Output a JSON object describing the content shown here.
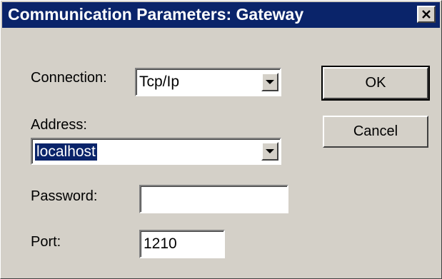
{
  "window": {
    "title": "Communication Parameters: Gateway",
    "close_glyph": "✕"
  },
  "form": {
    "connection_label": "Connection:",
    "connection_value": "Tcp/Ip",
    "address_label": "Address:",
    "address_value": "localhost",
    "password_label": "Password:",
    "password_value": "",
    "port_label": "Port:",
    "port_value": "1210"
  },
  "buttons": {
    "ok_label": "OK",
    "cancel_label": "Cancel"
  },
  "icons": {
    "close": "close-icon",
    "dropdown": "chevron-down-icon"
  },
  "colors": {
    "titlebar": "#0a246a",
    "face": "#d4d0c8",
    "selection": "#0a246a"
  }
}
